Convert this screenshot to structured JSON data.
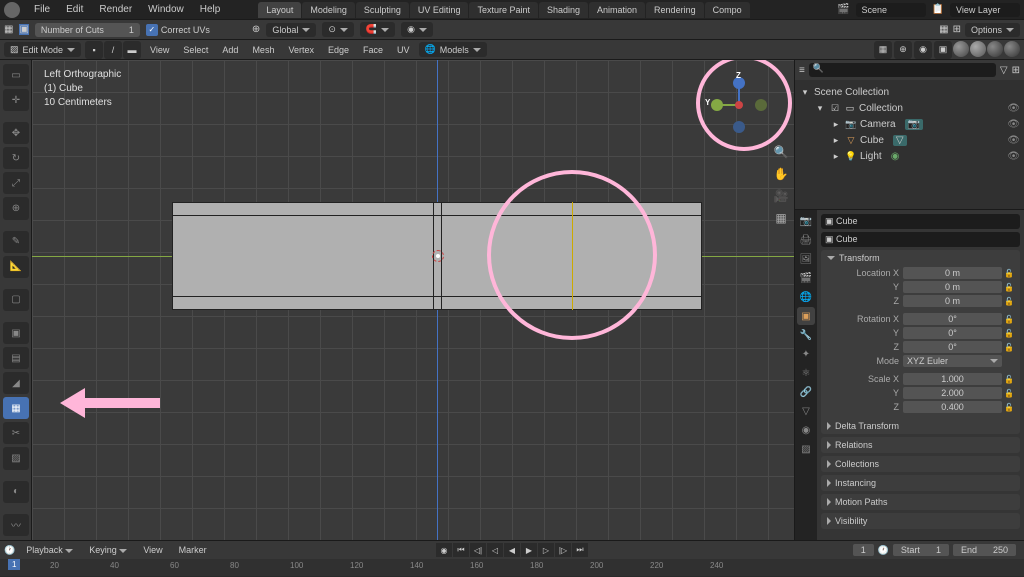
{
  "menu": [
    "File",
    "Edit",
    "Render",
    "Window",
    "Help"
  ],
  "workspaces": [
    "Layout",
    "Modeling",
    "Sculpting",
    "UV Editing",
    "Texture Paint",
    "Shading",
    "Animation",
    "Rendering",
    "Compo"
  ],
  "active_workspace": 0,
  "scene": {
    "scene_label": "Scene",
    "layer_label": "View Layer"
  },
  "tool_opts": {
    "num_cuts_label": "Number of Cuts",
    "num_cuts_value": "1",
    "correct_uvs": "Correct UVs",
    "orient": "Global",
    "options": "Options"
  },
  "header3": {
    "mode": "Edit Mode",
    "menus": [
      "View",
      "Select",
      "Add",
      "Mesh",
      "Vertex",
      "Edge",
      "Face",
      "UV"
    ],
    "models": "Models"
  },
  "viewport_info": {
    "view": "Left Orthographic",
    "obj": "(1) Cube",
    "scale": "10 Centimeters"
  },
  "gizmo": {
    "y": "Y",
    "z": "Z"
  },
  "outliner": {
    "search_placeholder": "",
    "root": "Scene Collection",
    "coll": "Collection",
    "items": [
      "Camera",
      "Cube",
      "Light"
    ]
  },
  "props": {
    "crumb1": "Cube",
    "crumb2": "Cube",
    "transform": "Transform",
    "loc_label": "Location X",
    "loc": [
      "0 m",
      "0 m",
      "0 m"
    ],
    "rot_label": "Rotation X",
    "rot": [
      "0°",
      "0°",
      "0°"
    ],
    "mode_label": "Mode",
    "mode_val": "XYZ Euler",
    "scale_label": "Scale X",
    "scale": [
      "1.000",
      "2.000",
      "0.400"
    ],
    "axes": [
      "Y",
      "Z"
    ],
    "delta": "Delta Transform",
    "sections": [
      "Relations",
      "Collections",
      "Instancing",
      "Motion Paths",
      "Visibility"
    ]
  },
  "timeline": {
    "menus": [
      "Playback",
      "Keying",
      "View",
      "Marker"
    ],
    "current": "1",
    "start_label": "Start",
    "start": "1",
    "end_label": "End",
    "end": "250",
    "ticks": [
      "1",
      "20",
      "40",
      "60",
      "80",
      "100",
      "120",
      "140",
      "160",
      "180",
      "200",
      "220",
      "240"
    ]
  }
}
